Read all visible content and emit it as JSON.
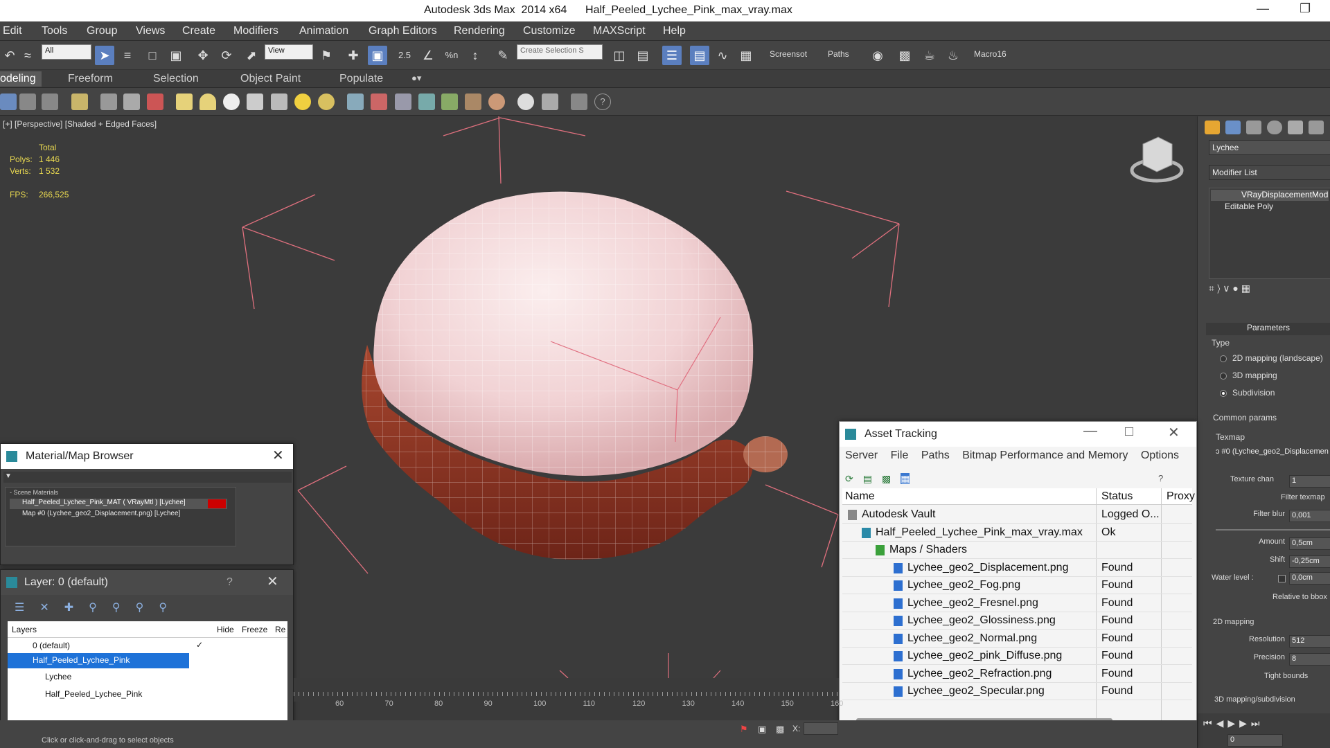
{
  "window": {
    "title": "Autodesk 3ds Max  2014 x64      Half_Peeled_Lychee_Pink_max_vray.max"
  },
  "menu": [
    "Edit",
    "Tools",
    "Group",
    "Views",
    "Create",
    "Modifiers",
    "Animation",
    "Graph Editors",
    "Rendering",
    "Customize",
    "MAXScript",
    "Help"
  ],
  "toolbar": {
    "filter_value": "All",
    "view_value": "View",
    "selection_set_placeholder": "Create Selection S",
    "snap_labels": [
      "2.5",
      "%n"
    ],
    "screenshot_label": "Screensot",
    "paths_label": "Paths",
    "macro_label": "Macro16"
  },
  "ribbon_tabs": [
    "odeling",
    "Freeform",
    "Selection",
    "Object Paint",
    "Populate"
  ],
  "viewport": {
    "label": "[+] [Perspective] [Shaded + Edged Faces]",
    "stats": {
      "total_label": "Total",
      "polys_label": "Polys:",
      "polys_value": "1 446",
      "verts_label": "Verts:",
      "verts_value": "1 532",
      "fps_label": "FPS:",
      "fps_value": "266,525"
    }
  },
  "material_browser": {
    "title": "Material/Map Browser",
    "section": "- Scene Materials",
    "items": [
      "Half_Peeled_Lychee_Pink_MAT ( VRayMtl ) [Lychee]",
      "Map #0 (Lychee_geo2_Displacement.png) [Lychee]"
    ]
  },
  "layer_window": {
    "title": "Layer: 0 (default)",
    "help": "?",
    "columns": [
      "Layers",
      "Hide",
      "Freeze",
      "Re"
    ],
    "rows": [
      "0 (default)",
      "Half_Peeled_Lychee_Pink",
      "Lychee",
      "Half_Peeled_Lychee_Pink"
    ]
  },
  "asset_tracking": {
    "title": "Asset Tracking",
    "menu": [
      "Server",
      "File",
      "Paths",
      "Bitmap Performance and Memory",
      "Options"
    ],
    "columns": [
      "Name",
      "Status",
      "Proxy"
    ],
    "rows": [
      {
        "name": "Autodesk Vault",
        "status": "Logged O..."
      },
      {
        "name": "Half_Peeled_Lychee_Pink_max_vray.max",
        "status": "Ok"
      },
      {
        "name": "Maps / Shaders",
        "status": ""
      },
      {
        "name": "Lychee_geo2_Displacement.png",
        "status": "Found"
      },
      {
        "name": "Lychee_geo2_Fog.png",
        "status": "Found"
      },
      {
        "name": "Lychee_geo2_Fresnel.png",
        "status": "Found"
      },
      {
        "name": "Lychee_geo2_Glossiness.png",
        "status": "Found"
      },
      {
        "name": "Lychee_geo2_Normal.png",
        "status": "Found"
      },
      {
        "name": "Lychee_geo2_pink_Diffuse.png",
        "status": "Found"
      },
      {
        "name": "Lychee_geo2_Refraction.png",
        "status": "Found"
      },
      {
        "name": "Lychee_geo2_Specular.png",
        "status": "Found"
      }
    ]
  },
  "command_panel": {
    "object_name": "Lychee",
    "modifier_list": "Modifier List",
    "stack": [
      "VRayDisplacementMod",
      "Editable Poly"
    ],
    "parameters_title": "Parameters",
    "type_label": "Type",
    "type_options": [
      "2D mapping (landscape)",
      "3D mapping",
      "Subdivision"
    ],
    "common_params": "Common params",
    "texmap_label": "Texmap",
    "texmap_value": "ɔ #0 (Lychee_geo2_Displacemen",
    "texture_chan_label": "Texture chan",
    "texture_chan_value": "1",
    "filter_texmap": "Filter texmap",
    "filter_blur_label": "Filter blur",
    "filter_blur_value": "0,001",
    "amount_label": "Amount",
    "amount_value": "0,5cm",
    "shift_label": "Shift",
    "shift_value": "-0,25cm",
    "water_level_label": "Water level :",
    "water_level_value": "0,0cm",
    "relative_bbox": "Relative to bbox",
    "mapping_2d": "2D mapping",
    "resolution_label": "Resolution",
    "resolution_value": "512",
    "precision_label": "Precision",
    "precision_value": "8",
    "tight_bounds": "Tight bounds",
    "mapping_3d": "3D mapping/subdivision"
  },
  "timeline": {
    "ticks": [
      "60",
      "70",
      "80",
      "90",
      "100",
      "110",
      "120",
      "130",
      "140",
      "150",
      "160"
    ]
  },
  "status": {
    "prompt": "Click or click-and-drag to select objects",
    "frame_value": "0",
    "x_label": "X:"
  }
}
